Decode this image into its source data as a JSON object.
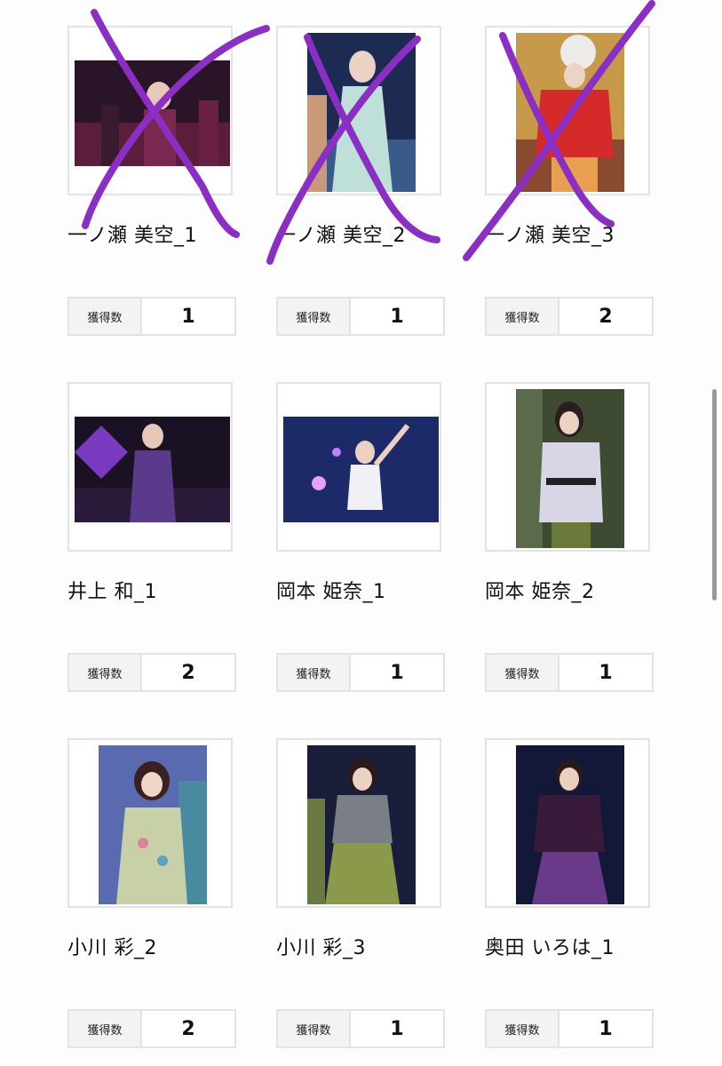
{
  "count_label": "獲得数",
  "cards": [
    {
      "name": "一ノ瀬 美空_1",
      "count": "1",
      "crossed_out": true
    },
    {
      "name": "一ノ瀬 美空_2",
      "count": "1",
      "crossed_out": true
    },
    {
      "name": "一ノ瀬 美空_3",
      "count": "2",
      "crossed_out": true
    },
    {
      "name": "井上 和_1",
      "count": "2",
      "crossed_out": false
    },
    {
      "name": "岡本 姫奈_1",
      "count": "1",
      "crossed_out": false
    },
    {
      "name": "岡本 姫奈_2",
      "count": "1",
      "crossed_out": false
    },
    {
      "name": "小川 彩_2",
      "count": "2",
      "crossed_out": false
    },
    {
      "name": "小川 彩_3",
      "count": "1",
      "crossed_out": false
    },
    {
      "name": "奥田 いろは_1",
      "count": "1",
      "crossed_out": false
    }
  ],
  "colors": {
    "cross_mark": "#8a2ec4",
    "border": "#e3e3e3",
    "label_bg": "#f3f3f3"
  }
}
